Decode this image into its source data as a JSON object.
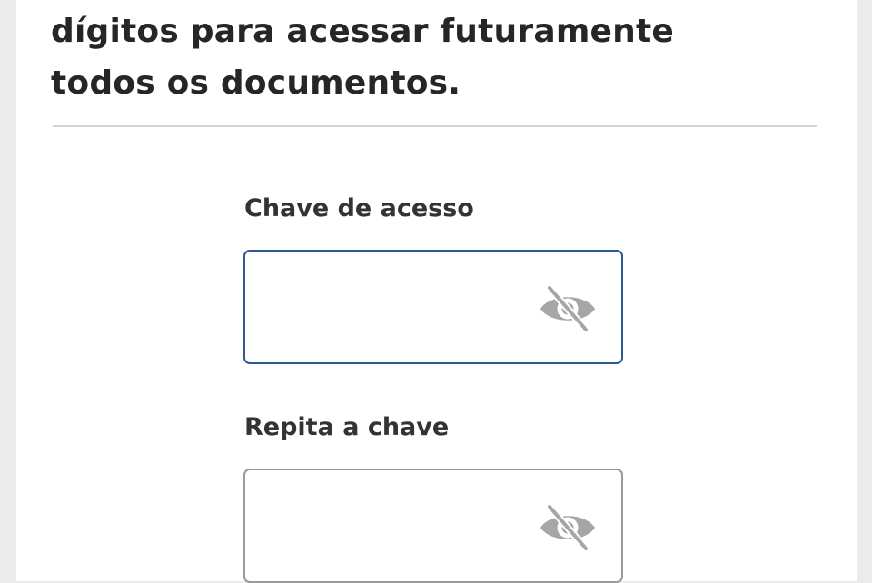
{
  "intro": {
    "line1": "dígitos para acessar futuramente",
    "line2": "todos os documentos."
  },
  "form": {
    "access_key": {
      "label": "Chave de acesso",
      "value": "",
      "icon": "eye-off-icon"
    },
    "repeat_key": {
      "label": "Repita a chave",
      "value": "",
      "icon": "eye-off-icon"
    }
  },
  "colors": {
    "focused_border": "#2d5891",
    "default_border": "#9a9a9a",
    "icon": "#a6a6a6",
    "text": "#262626"
  }
}
